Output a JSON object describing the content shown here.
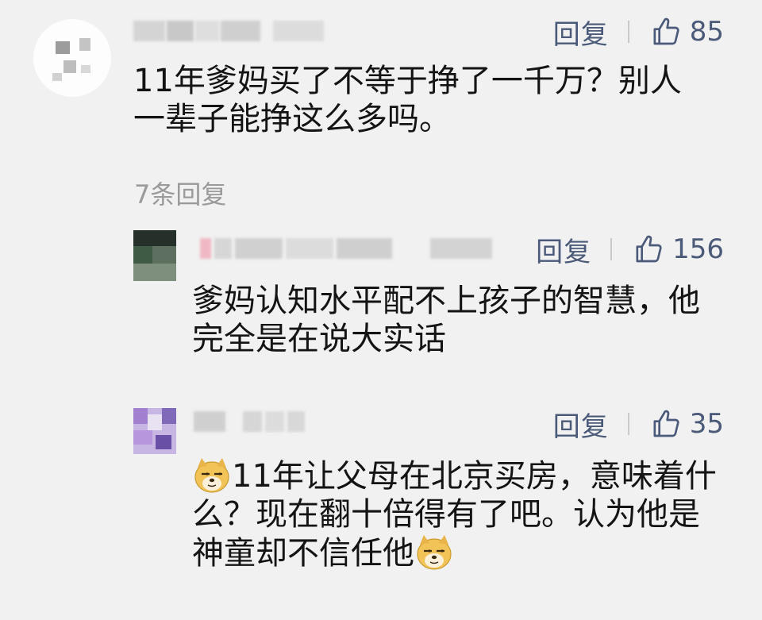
{
  "comments": [
    {
      "reply_label": "回复",
      "likes": "85",
      "text": "11年爹妈买了不等于挣了一千万？别人一辈子能挣这么多吗。",
      "replies_link": "7条回复"
    },
    {
      "reply_label": "回复",
      "likes": "156",
      "text": "爹妈认知水平配不上孩子的智慧，他完全是在说大实话"
    },
    {
      "reply_label": "回复",
      "likes": "35",
      "text_part1": "11年让父母在北京买房，意味着什么？现在翻十倍得有了吧。认为他是神童却不信任他"
    }
  ],
  "colors": {
    "background": "#f1f1f1",
    "action_text": "#4a5a78",
    "meta_text": "#9a9a9a",
    "body_text": "#141414"
  },
  "icons": [
    "thumbs-up-icon",
    "doge-emoji-icon"
  ]
}
